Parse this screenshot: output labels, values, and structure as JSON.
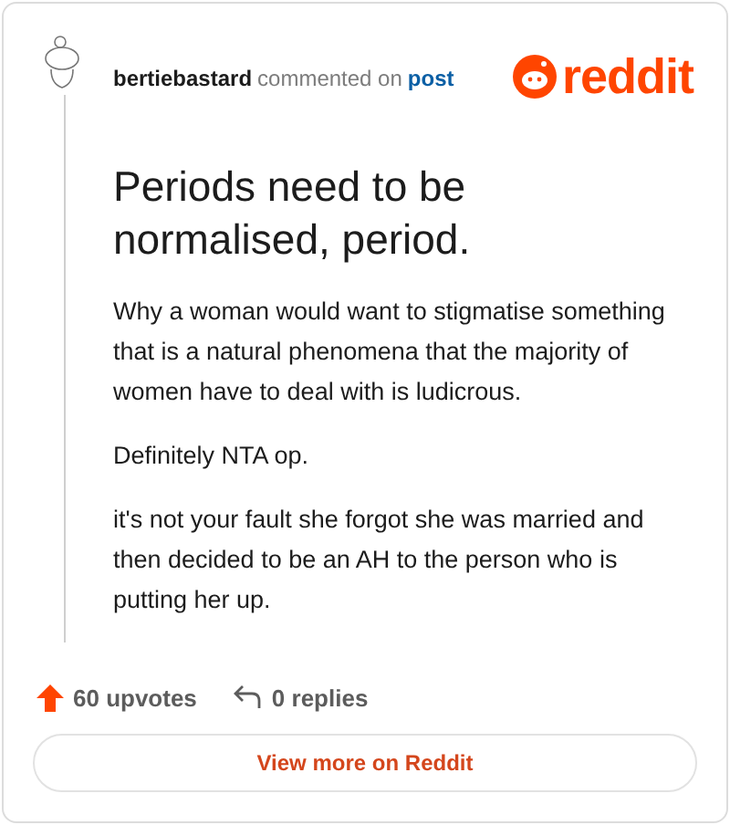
{
  "header": {
    "author": "bertiebastard",
    "action": "commented on",
    "link": "post",
    "logo_text": "reddit"
  },
  "comment": {
    "title": "Periods need to be normalised, period.",
    "paragraphs": [
      "Why a woman would want to stigmatise something that is a natural phenomena that the majority of women have to deal with is ludicrous.",
      "Definitely NTA op.",
      "it's not your fault she forgot she was married and then decided to be an AH to the person who is putting her up."
    ]
  },
  "footer": {
    "upvotes": "60 upvotes",
    "replies": "0 replies"
  },
  "button": "View more on Reddit"
}
